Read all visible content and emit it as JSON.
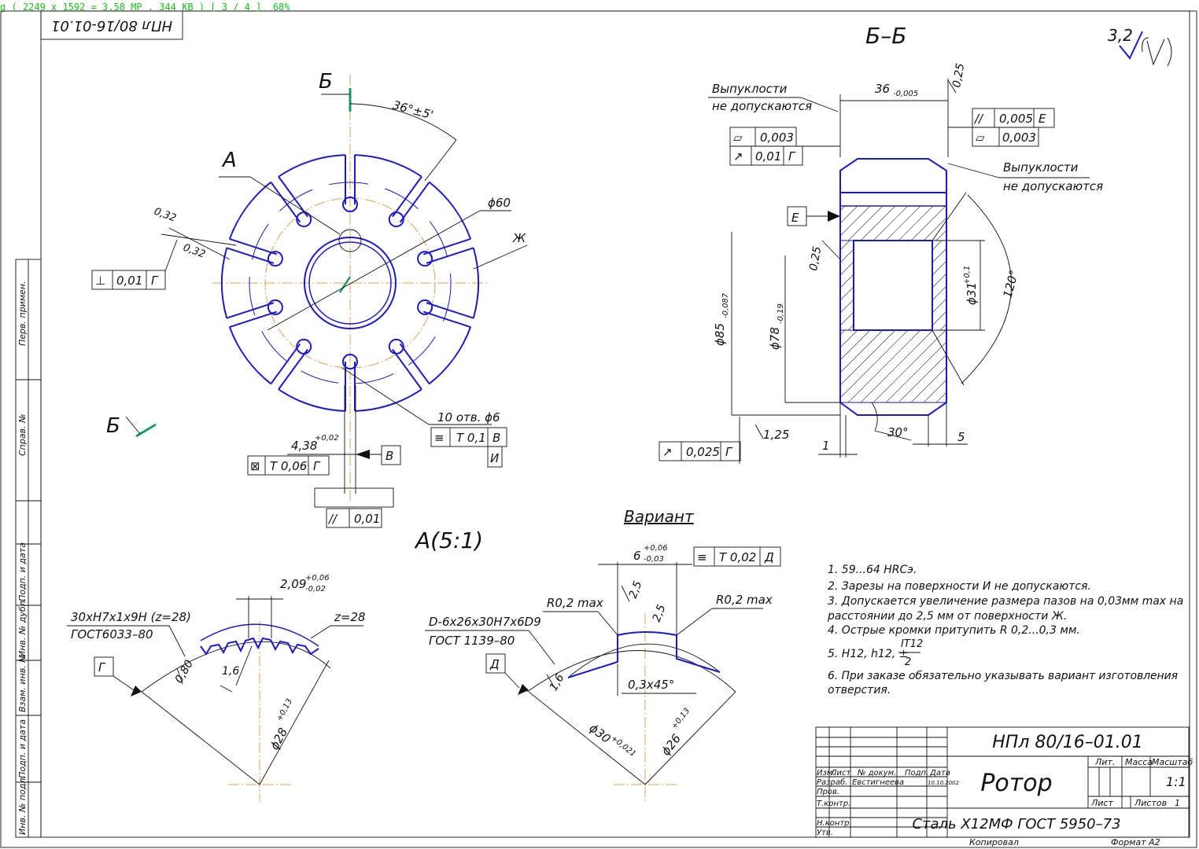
{
  "viewer": {
    "status": "g ( 2249 x 1592 = 3.58 MP , 344 KB ) [ 3 / 4 ]  68%",
    "status_color": "#19c219"
  },
  "colors": {
    "outline": "#1a1acc",
    "dimension": "#111111",
    "centerline": "#e0a050",
    "marker": "#1a9a6a"
  },
  "stamp_top": "НПл 80/16-01.01",
  "roughness_symbol": "3,2",
  "side_column": [
    "Перв. примен.",
    "Справ. №",
    "Подп. и дата",
    "Инв. № дубл.",
    "Взам. инв. №",
    "Подп. и дата",
    "Инв. № подл."
  ],
  "front_view": {
    "section_label_top": "Б",
    "section_label_bottom": "Б",
    "detail_label": "А",
    "angle_dim": "36°±5'",
    "dia_dim": "ϕ60",
    "zh_label": "Ж",
    "dim_032_a": "0,32",
    "dim_032_b": "0,32",
    "perp_tol": {
      "symbol": "⊥",
      "value": "0,01",
      "base": "Г"
    },
    "holes_note": "10 отв. ϕ6",
    "sym_tol": {
      "symbol": "≡",
      "value": "Т 0,1",
      "base": "В",
      "base2": "И"
    },
    "slot_dim": "4,38",
    "slot_dim_tol": "+0,02",
    "pos_tol": {
      "symbol": "⊠",
      "value": "Т 0,06",
      "base": "Г"
    },
    "datum_v": "В",
    "par_tol": {
      "symbol": "//",
      "value": "0,01"
    }
  },
  "section_view": {
    "title": "Б–Б",
    "note_left_1": "Выпуклости",
    "note_left_2": "не допускаются",
    "note_right_1": "Выпуклости",
    "note_right_2": "не допускаются",
    "width_dim": "36",
    "width_tol": "-0,005",
    "rough_025_top": "0,25",
    "rough_025_left": "0,25",
    "par_tol": {
      "symbol": "//",
      "value": "0,005",
      "base": "Е"
    },
    "flat_tol_right": {
      "symbol": "▱",
      "value": "0,003"
    },
    "flat_tol_left": {
      "symbol": "▱",
      "value": "0,003"
    },
    "runout_tol": {
      "symbol": "↗",
      "value": "0,01",
      "base": "Г"
    },
    "datum_e": "Е",
    "d85": "ϕ85",
    "d85_tol": "-0,087",
    "d78": "ϕ78",
    "d78_tol": "-0,19",
    "d31": "ϕ31",
    "d31_tol": "+0,1",
    "angle_120": "120°",
    "angle_30": "30°",
    "rough_125": "1,25",
    "dim_1": "1",
    "dim_5": "5",
    "runout_bottom": {
      "symbol": "↗",
      "value": "0,025",
      "base": "Г"
    }
  },
  "detail_a": {
    "title": "А(5:1)",
    "spline_1": "30хН7х1х9Н (z=28)",
    "spline_2": "ГОСТ6033–80",
    "tooth_dim": "2,09",
    "tooth_tol_up": "+0,06",
    "tooth_tol_dn": "-0,02",
    "z_label": "z=28",
    "datum_g": "Г",
    "rough_080": "0,80",
    "rough_16": "1,6",
    "d28": "ϕ28",
    "d28_tol": "+0,13"
  },
  "variant": {
    "title": "Вариант",
    "width_dim": "6",
    "width_up": "+0,06",
    "width_dn": "-0,03",
    "sym_tol": {
      "symbol": "≡",
      "value": "Т 0,02",
      "base": "Д"
    },
    "spline_1": "D-6х26х30Н7х6D9",
    "spline_2": "ГОСТ 1139–80",
    "datum_d": "Д",
    "r_left": "R0,2 max",
    "r_right": "R0,2 max",
    "rough_25a": "2,5",
    "rough_25b": "2,5",
    "rough_16": "1,6",
    "chamfer": "0,3х45°",
    "d30": "ϕ30",
    "d30_tol": "+0,021",
    "d26": "ϕ26",
    "d26_tol": "+0,13"
  },
  "notes": [
    "1. 59...64 HRCэ.",
    "2. Зарезы на поверхности И не допускаются.",
    "3. Допускается увеличение размера пазов на 0,03мм max на",
    "расстоянии до 2,5 мм от поверхности Ж.",
    "4. Острые кромки притупить R 0,2...0,3 мм.",
    "5. H12, h12, ±",
    "IT12",
    "2",
    "6. При заказе обязательно указывать вариант изготовления",
    "отверстия."
  ],
  "title_block": {
    "designation": "НПл 80/16–01.01",
    "name": "Ротор",
    "material": "Сталь Х12МФ ГОСТ 5950–73",
    "col_izm": "Изм.",
    "col_list": "Лист",
    "col_doc": "№ докум.",
    "col_sign": "Подп.",
    "col_date": "Дата",
    "row_razrab": "Разраб.",
    "razrab_name": "Евстигнеева",
    "razrab_date": "10.10.2002",
    "row_prov": "Пров.",
    "row_tkontr": "Т.контр.",
    "row_nkontr": "Н.контр.",
    "row_utv": "Утв.",
    "lit": "Лит.",
    "massa": "Масса",
    "masshtab": "Масштаб",
    "scale_value": "1:1",
    "list_label": "Лист",
    "listov_label": "Листов",
    "listov_value": "1",
    "kopiroval": "Копировал",
    "format": "Формат   А2"
  }
}
